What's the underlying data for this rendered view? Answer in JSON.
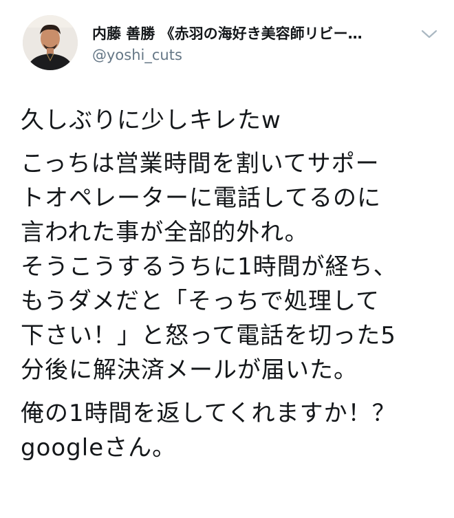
{
  "tweet": {
    "display_name": "内藤 善勝 《赤羽の海好き美容師リビー…",
    "handle": "@yoshi_cuts",
    "chevron_icon": "chevron-down-icon",
    "avatar_icon": "avatar",
    "paragraphs": [
      "久しぶりに少しキレたw",
      "こっちは営業時間を割いてサポー\nトオペレーターに電話してるのに\n言われた事が全部的外れ。\nそうこうするうちに1時間が経ち、\nもうダメだと「そっちで処理して\n下さい！」と怒って電話を切った5\n分後に解決済メールが届いた。",
      "俺の1時間を返してくれますか！？\ngoogleさん。"
    ]
  },
  "colors": {
    "name": "#14171a",
    "handle": "#657786",
    "chevron": "#aab8c2",
    "background": "#ffffff"
  }
}
